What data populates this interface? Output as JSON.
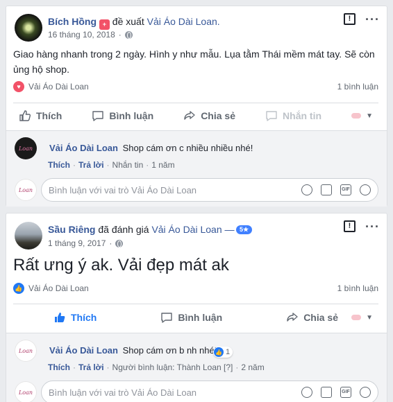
{
  "posts": [
    {
      "author": "Bích Hồng",
      "verb": "đề xuất",
      "page": "Vải Áo Dài Loan.",
      "date": "16 tháng 10, 2018",
      "text": "Giao hàng nhanh trong 2 ngày. Hình y như mẫu. Lụa tằm Thái mềm mát tay. Sẽ còn ủng hộ shop.",
      "reactor": "Vải Áo Dài Loan",
      "comment_count": "1 bình luận",
      "actions": {
        "like": "Thích",
        "comment": "Bình luận",
        "share": "Chia sẻ",
        "message": "Nhắn tin"
      },
      "comment": {
        "name": "Vải Áo Dài Loan",
        "text": "Shop cám ơn c nhiều nhiều nhé!",
        "meta": [
          "Thích",
          "Trả lời",
          "Nhắn tin",
          "1 năm"
        ]
      },
      "compose_placeholder": "Bình luận với vai trò Vải Áo Dài Loan"
    },
    {
      "author": "Sầu Riêng",
      "verb": "đã đánh giá",
      "page": "Vải Áo Dài Loan —",
      "rating": "5★",
      "date": "1 tháng 9, 2017",
      "text": "Rất ưng ý ak. Vải đẹp mát ak",
      "reactor": "Vải Áo Dài Loan",
      "comment_count": "1 bình luận",
      "actions": {
        "like": "Thích",
        "comment": "Bình luận",
        "share": "Chia sẻ"
      },
      "comment": {
        "name": "Vải Áo Dài Loan",
        "text": "Shop cám ơn b nh nhé!",
        "like_count": "1",
        "meta": [
          "Thích",
          "Trả lời",
          "Người bình luận: Thành Loan [?]",
          "2 năm"
        ]
      },
      "compose_placeholder": "Bình luận với vai trò Vải Áo Dài Loan"
    }
  ],
  "logo_text": "Loan",
  "colors": {
    "link": "#385898",
    "like_blue": "#2078f4",
    "love_red": "#f25268",
    "stars_badge": "#4080ff"
  }
}
